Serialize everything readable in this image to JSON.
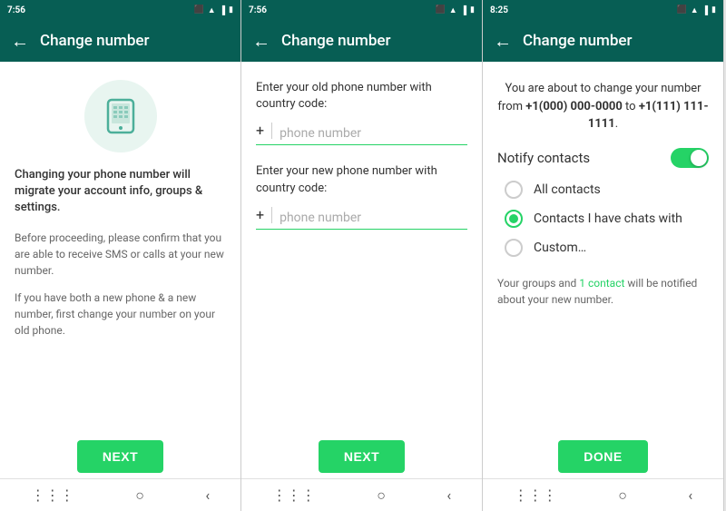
{
  "panel1": {
    "time": "7:56",
    "title": "Change number",
    "main_text": "Changing your phone number will migrate your account info, groups & settings.",
    "sub_text1": "Before proceeding, please confirm that you are able to receive SMS or calls at your new number.",
    "sub_text2": "If you have both a new phone & a new number, first change your number on your old phone.",
    "next_button": "NEXT"
  },
  "panel2": {
    "time": "7:56",
    "title": "Change number",
    "old_label": "Enter your old phone number with country code:",
    "new_label": "Enter your new phone number with country code:",
    "placeholder": "phone number",
    "next_button": "NEXT"
  },
  "panel3": {
    "time": "8:25",
    "title": "Change number",
    "info_text_prefix": "You are about to change your number from ",
    "old_number": "+1(000) 000-0000",
    "info_text_mid": " to ",
    "new_number": "+1(111) 111-1111",
    "info_text_suffix": ".",
    "notify_label": "Notify contacts",
    "option_all": "All contacts",
    "option_chats": "Contacts I have chats with",
    "option_custom": "Custom…",
    "groups_text_prefix": "Your groups and ",
    "contact_link": "1 contact",
    "groups_text_suffix": " will be notified about your new number.",
    "done_button": "DONE"
  }
}
